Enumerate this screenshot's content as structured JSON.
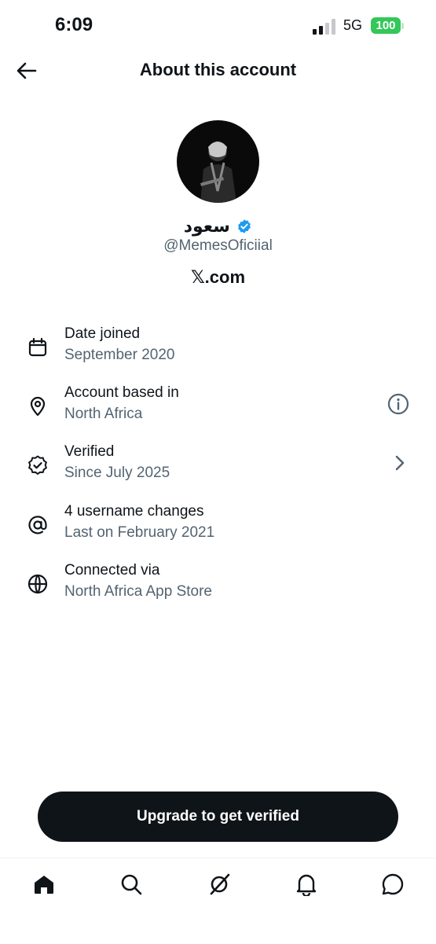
{
  "status_bar": {
    "time": "6:09",
    "network": "5G",
    "battery": "100"
  },
  "header": {
    "title": "About this account"
  },
  "profile": {
    "name": "سعود",
    "handle": "@MemesOficiial",
    "domain": "𝕏.com"
  },
  "details": [
    {
      "icon": "calendar-icon",
      "label": "Date joined",
      "value": "September 2020"
    },
    {
      "icon": "location-pin-icon",
      "label": "Account based in",
      "value": "North Africa"
    },
    {
      "icon": "verified-badge-icon",
      "label": "Verified",
      "value": "Since July 2025"
    },
    {
      "icon": "at-sign-icon",
      "label": "4 username changes",
      "value": "Last on February 2021"
    },
    {
      "icon": "globe-icon",
      "label": "Connected via",
      "value": "North Africa App Store"
    }
  ],
  "upgrade_button": {
    "label": "Upgrade to get verified"
  },
  "nav": [
    "home-icon",
    "search-icon",
    "grok-icon",
    "notifications-icon",
    "messages-icon"
  ],
  "colors": {
    "primary_text": "#0f1419",
    "secondary_text": "#536471",
    "verified_blue": "#1d9bf0",
    "battery_green": "#34c759"
  }
}
